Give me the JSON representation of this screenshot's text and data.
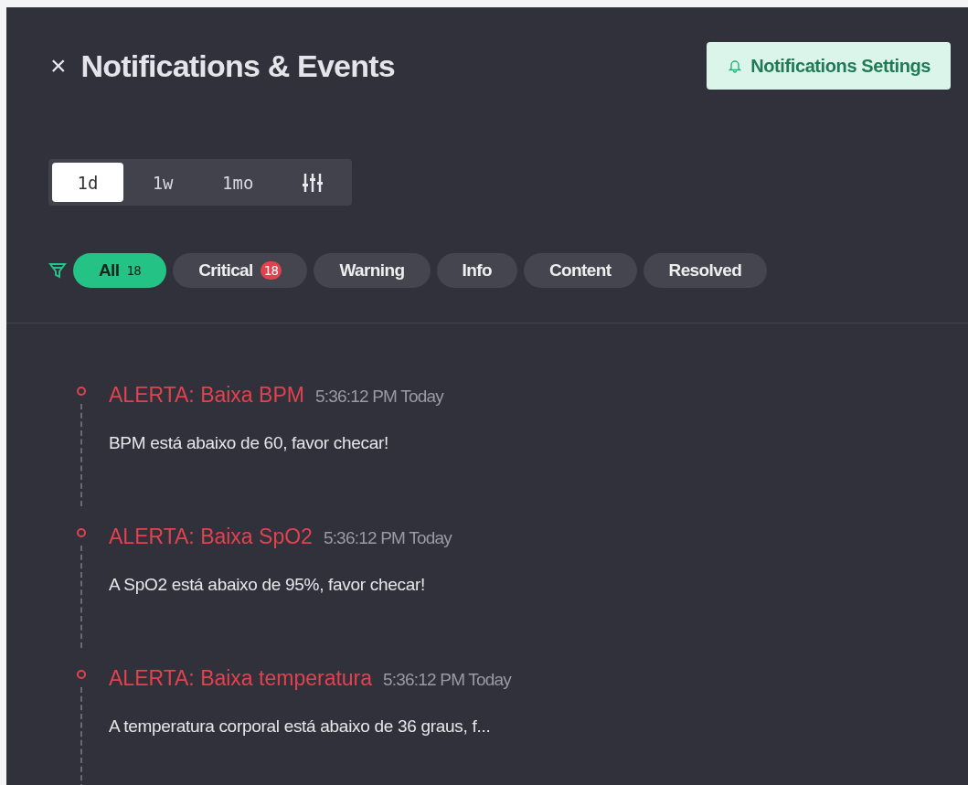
{
  "header": {
    "close": "×",
    "title": "Notifications & Events",
    "settings_button": "Notifications Settings"
  },
  "ranges": [
    {
      "label": "1d",
      "selected": true
    },
    {
      "label": "1w",
      "selected": false
    },
    {
      "label": "1mo",
      "selected": false
    }
  ],
  "filters": [
    {
      "label": "All",
      "selected": true,
      "count": {
        "text": "18",
        "kind": "plain"
      }
    },
    {
      "label": "Critical",
      "selected": false,
      "count": {
        "text": "18",
        "kind": "badge"
      }
    },
    {
      "label": "Warning",
      "selected": false
    },
    {
      "label": "Info",
      "selected": false
    },
    {
      "label": "Content",
      "selected": false
    },
    {
      "label": "Resolved",
      "selected": false
    }
  ],
  "events": [
    {
      "kind": "critical",
      "title": "ALERTA: Baixa BPM",
      "time": "5:36:12 PM Today",
      "message": "BPM está abaixo de 60, favor checar!"
    },
    {
      "kind": "critical",
      "title": "ALERTA: Baixa SpO2",
      "time": "5:36:12 PM Today",
      "message": "A SpO2 está abaixo de 95%, favor checar!"
    },
    {
      "kind": "critical",
      "title": "ALERTA: Baixa temperatura",
      "time": "5:36:12 PM Today",
      "message": "A temperatura corporal está abaixo de 36 graus, f..."
    }
  ]
}
